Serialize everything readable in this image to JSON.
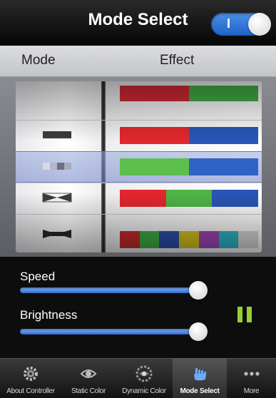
{
  "header": {
    "title": "Mode Select",
    "toggle": {
      "label": "I",
      "state": "on",
      "color": "#2f7ae0"
    }
  },
  "columns": {
    "mode": "Mode",
    "effect": "Effect"
  },
  "picker": {
    "selected_index": 2,
    "rows": [
      {
        "mode_icon": "bar-icon",
        "effect_colors": [
          "#d32a34",
          "#d32a34",
          "#44b044",
          "#44b044"
        ]
      },
      {
        "mode_icon": "bar-icon",
        "effect_colors": [
          "#e0282e",
          "#e0282e",
          "#2857b8",
          "#2857b8"
        ]
      },
      {
        "mode_icon": "fade-bar-icon",
        "effect_colors": [
          "#5cbf4e",
          "#5cbf4e",
          "#2f63c4",
          "#2f63c4"
        ]
      },
      {
        "mode_icon": "bowtie-icon",
        "effect_colors": [
          "#e42630",
          "#4fb447",
          "#2a55b5"
        ]
      },
      {
        "mode_icon": "bowtie-icon",
        "effect_colors": [
          "#c42a2e",
          "#3fae46",
          "#2c4fae",
          "#d8c21e",
          "#a046b8",
          "#2eb7c8",
          "#d8d8d8"
        ]
      }
    ]
  },
  "controls": {
    "speed": {
      "label": "Speed",
      "value": 1.0
    },
    "brightness": {
      "label": "Brightness",
      "value": 1.0
    },
    "pause_icon": "pause-icon",
    "pause_color": "#9acd32"
  },
  "tabs": [
    {
      "label": "About Controller",
      "icon": "gear-icon",
      "active": false
    },
    {
      "label": "Static Color",
      "icon": "eye-icon",
      "active": false
    },
    {
      "label": "Dynamic Color",
      "icon": "eye-gear-icon",
      "active": false
    },
    {
      "label": "Mode Select",
      "icon": "hand-icon",
      "active": true
    },
    {
      "label": "More",
      "icon": "more-dots-icon",
      "active": false
    }
  ]
}
